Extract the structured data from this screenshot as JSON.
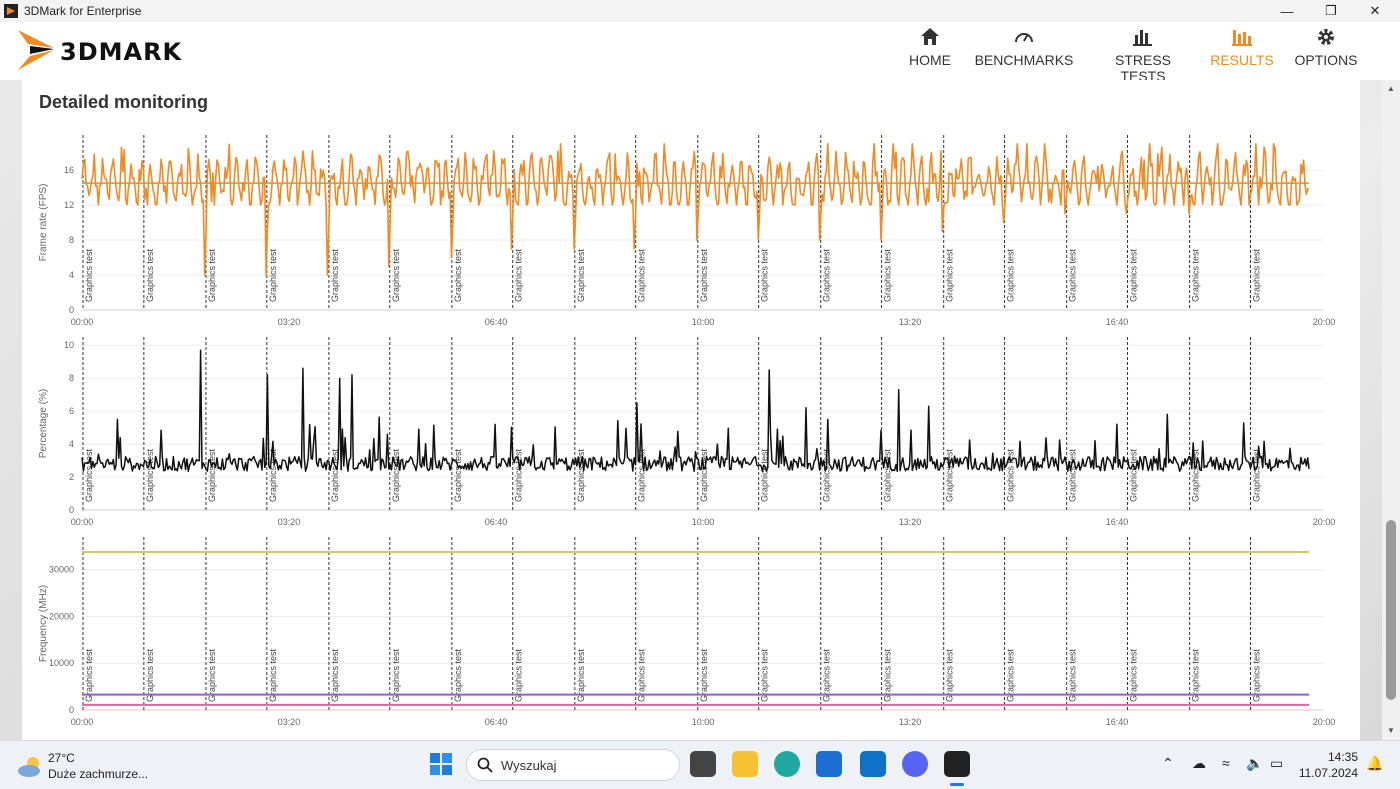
{
  "window": {
    "title": "3DMark for Enterprise"
  },
  "header": {
    "logo_text": "3DMARK",
    "nav": [
      {
        "label": "HOME",
        "icon": "home-icon",
        "active": false
      },
      {
        "label": "BENCHMARKS",
        "icon": "gauge-icon",
        "active": false
      },
      {
        "label": "STRESS TESTS",
        "icon": "bars-icon",
        "active": false
      },
      {
        "label": "RESULTS",
        "icon": "results-icon",
        "active": true
      },
      {
        "label": "OPTIONS",
        "icon": "gear-icon",
        "active": false
      }
    ]
  },
  "accent_color": "#f08a24",
  "section_title": "Detailed monitoring",
  "marker_label": "Graphics test",
  "chart_data": [
    {
      "type": "line",
      "ylabel": "Frame rate (FPS)",
      "ylim": [
        0,
        20
      ],
      "yticks": [
        0,
        4,
        8,
        12,
        16
      ],
      "xlim": [
        "00:00",
        "20:00"
      ],
      "xticks": [
        "00:00",
        "03:20",
        "06:40",
        "10:00",
        "13:20",
        "16:40",
        "20:00"
      ],
      "markers_count": 20,
      "series": [
        {
          "color": "#f08a24",
          "baseline": 14.5,
          "note_values": "oscillates ~12-18 FPS with dips to ~4 FPS at each Graphics test start",
          "dips": [
            4,
            4,
            4,
            5,
            6,
            7,
            7,
            7,
            8,
            8,
            8,
            8,
            9,
            10,
            11,
            11,
            11,
            12
          ]
        }
      ]
    },
    {
      "type": "line",
      "ylabel": "Percentage (%)",
      "ylim": [
        0,
        10.5
      ],
      "yticks": [
        0,
        2,
        4,
        6,
        8,
        10
      ],
      "xlim": [
        "00:00",
        "20:00"
      ],
      "xticks": [
        "00:00",
        "03:20",
        "06:40",
        "10:00",
        "13:20",
        "16:40",
        "20:00"
      ],
      "markers_count": 20,
      "series": [
        {
          "color": "#111111",
          "baseline": 2.8,
          "peaks": [
            9.7,
            8.2,
            8.6,
            8.0,
            8.2,
            5.5,
            6.5,
            6.2,
            8.5,
            5.5,
            7.3,
            6.3,
            5.2
          ]
        }
      ]
    },
    {
      "type": "line",
      "ylabel": "Frequency (MHz)",
      "ylim": [
        0,
        37000
      ],
      "yticks": [
        0,
        10000,
        20000,
        30000
      ],
      "xlim": [
        "00:00",
        "20:00"
      ],
      "xticks": [
        "00:00",
        "03:20",
        "06:40",
        "10:00",
        "13:20",
        "16:40",
        "20:00"
      ],
      "markers_count": 20,
      "series": [
        {
          "color": "#d6c76a",
          "value": 33800
        },
        {
          "color": "#9b59d0",
          "value": 3300
        },
        {
          "color": "#d86aa0",
          "value": 1100
        }
      ]
    }
  ],
  "taskbar": {
    "weather_temp": "27°C",
    "weather_desc": "Duże zachmurze...",
    "search_placeholder": "Wyszukaj",
    "time": "14:35",
    "date": "11.07.2024"
  }
}
